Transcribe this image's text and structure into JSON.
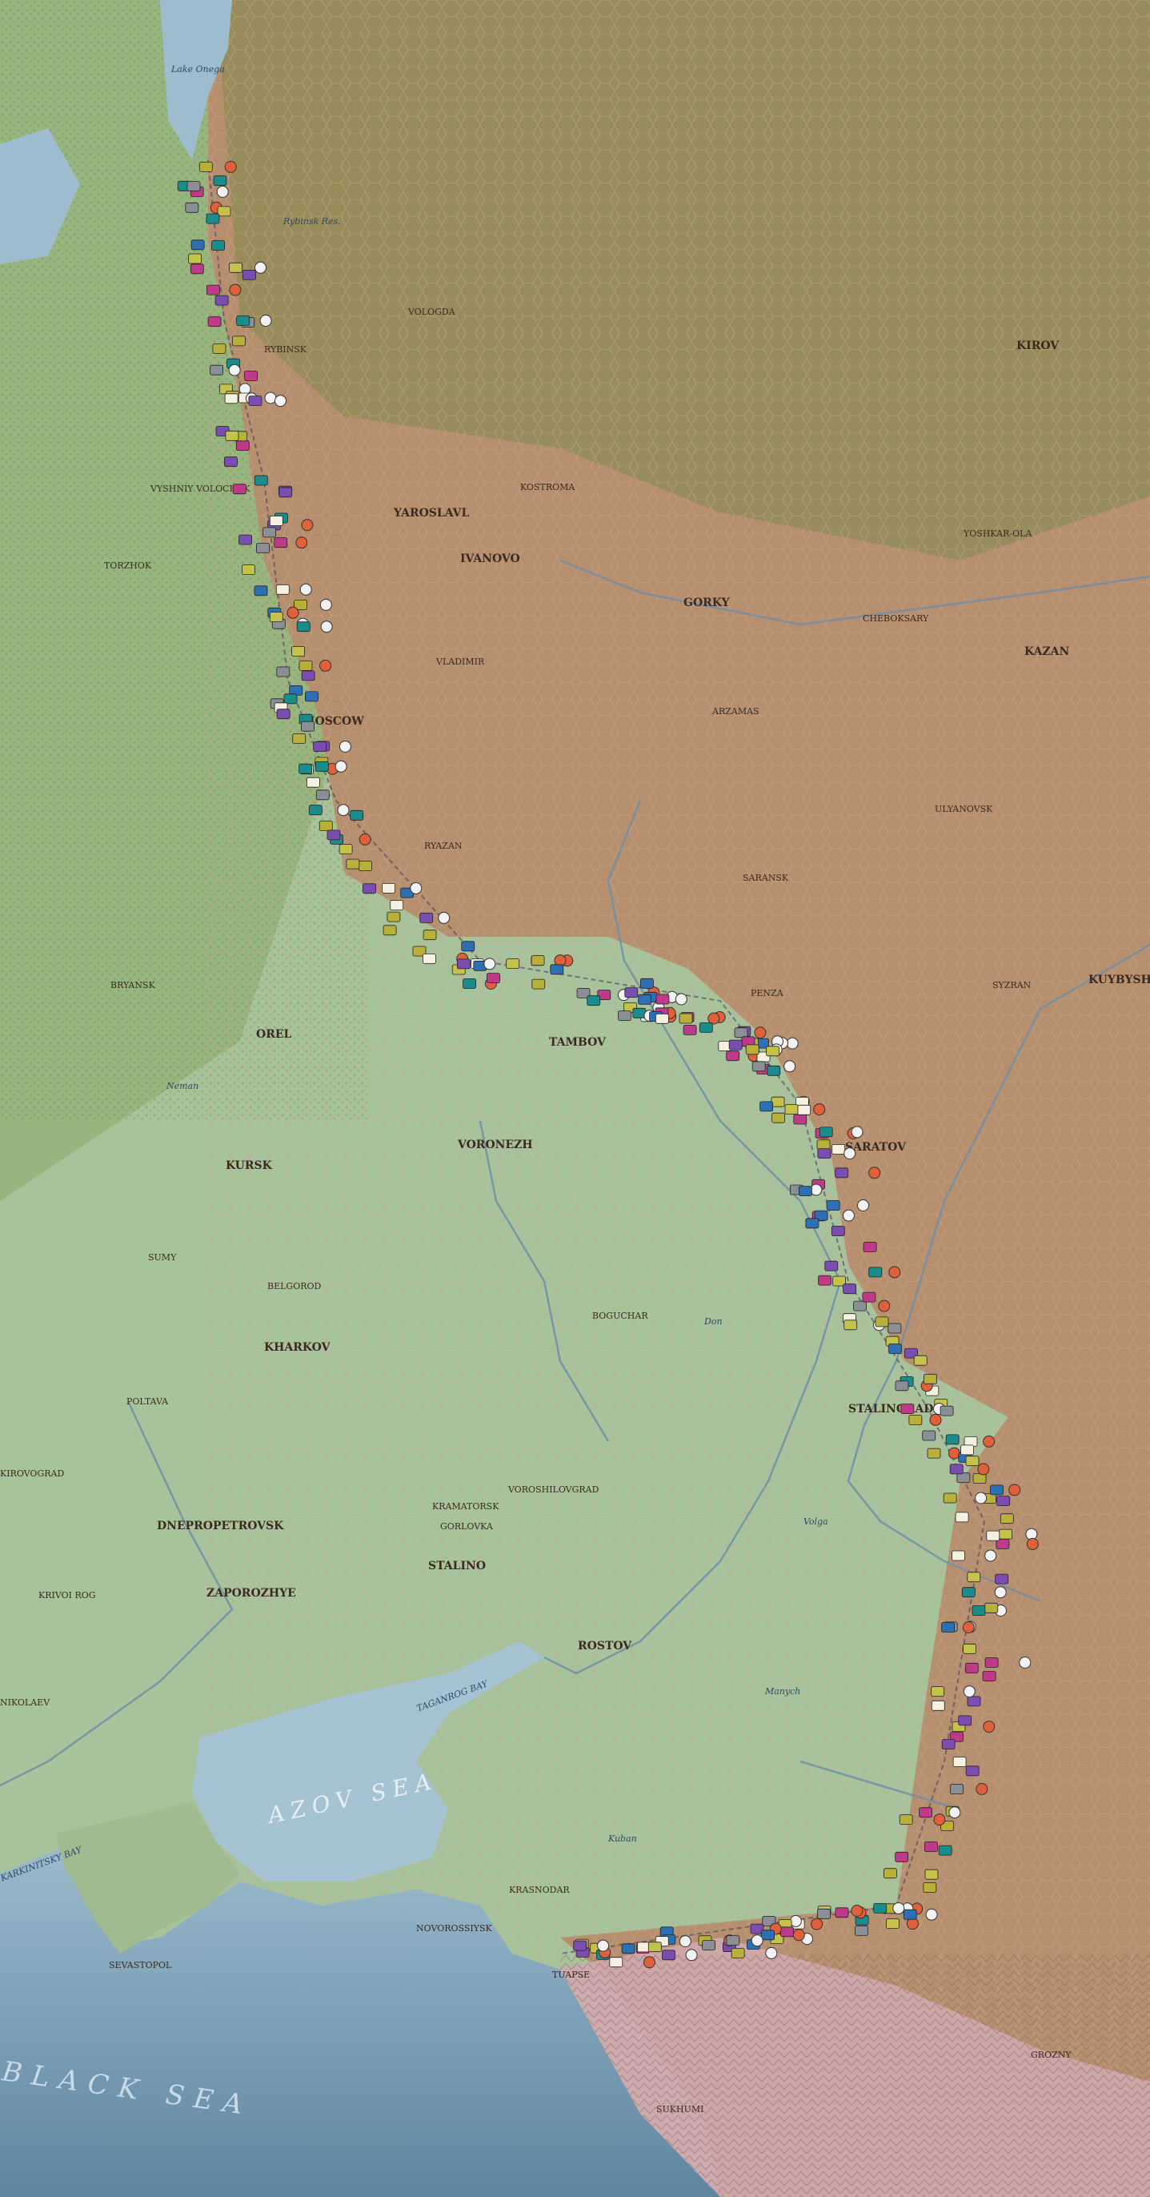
{
  "map": {
    "title": "",
    "colors": {
      "sea": "#8fb2c6",
      "deep_sea": "#6f93ab",
      "steppe": "#a9c49b",
      "forest": "#7f9e59",
      "occupied": "#b98a6a",
      "mountain": "#c9a6a6",
      "river": "#6f8ea8",
      "hexline": "#c9a48a",
      "axis_unit": "#b8b03a",
      "soviet_unit": "#f0f0e8"
    }
  },
  "labels": {
    "cities": [
      {
        "name": "KIROV",
        "cls": "big"
      },
      {
        "name": "KAZAN",
        "cls": "big"
      },
      {
        "name": "KUYBYSHEV",
        "cls": "big"
      },
      {
        "name": "YAROSLAVL",
        "cls": "big"
      },
      {
        "name": "IVANOVO",
        "cls": "big"
      },
      {
        "name": "GORKY",
        "cls": "big"
      },
      {
        "name": "MOSCOW",
        "cls": "big"
      },
      {
        "name": "OREL",
        "cls": "big"
      },
      {
        "name": "KURSK",
        "cls": "big"
      },
      {
        "name": "VORONEZH",
        "cls": "big"
      },
      {
        "name": "TAMBOV",
        "cls": "big"
      },
      {
        "name": "SARATOV",
        "cls": "big"
      },
      {
        "name": "KHARKOV",
        "cls": "big"
      },
      {
        "name": "DNEPROPETROVSK",
        "cls": "big"
      },
      {
        "name": "ZAPOROZHYE",
        "cls": "big"
      },
      {
        "name": "STALINO",
        "cls": "big"
      },
      {
        "name": "ROSTOV",
        "cls": "big"
      },
      {
        "name": "STALINGRAD",
        "cls": "big"
      },
      {
        "name": "VOLOGDA",
        "cls": ""
      },
      {
        "name": "RYBINSK",
        "cls": ""
      },
      {
        "name": "VLADIMIR",
        "cls": ""
      },
      {
        "name": "RYAZAN",
        "cls": ""
      },
      {
        "name": "PENZA",
        "cls": ""
      },
      {
        "name": "SARANSK",
        "cls": ""
      },
      {
        "name": "BRYANSK",
        "cls": ""
      },
      {
        "name": "BELGOROD",
        "cls": ""
      },
      {
        "name": "SUMY",
        "cls": ""
      },
      {
        "name": "POLTAVA",
        "cls": ""
      },
      {
        "name": "BOGUCHAR",
        "cls": ""
      },
      {
        "name": "VOROSHILOVGRAD",
        "cls": ""
      },
      {
        "name": "KRAMATORSK",
        "cls": ""
      },
      {
        "name": "GORLOVKA",
        "cls": ""
      },
      {
        "name": "KRIVOI ROG",
        "cls": ""
      },
      {
        "name": "NIKOLAEV",
        "cls": ""
      },
      {
        "name": "TORZHOK",
        "cls": ""
      },
      {
        "name": "VYSHNIY VOLOCHEK",
        "cls": ""
      },
      {
        "name": "KRASNODAR",
        "cls": ""
      },
      {
        "name": "NOVOROSSIYSK",
        "cls": ""
      },
      {
        "name": "SEVASTOPOL",
        "cls": ""
      },
      {
        "name": "TUAPSE",
        "cls": ""
      },
      {
        "name": "SUKHUMI",
        "cls": ""
      },
      {
        "name": "GROZNY",
        "cls": ""
      },
      {
        "name": "KOSTROMA",
        "cls": ""
      },
      {
        "name": "CHEBOKSARY",
        "cls": ""
      },
      {
        "name": "ULYANOVSK",
        "cls": ""
      },
      {
        "name": "ARZAMAS",
        "cls": ""
      },
      {
        "name": "YOSHKAR-OLA",
        "cls": ""
      },
      {
        "name": "SYZRAN",
        "cls": ""
      },
      {
        "name": "KIROVOGRAD",
        "cls": ""
      }
    ],
    "features": [
      {
        "name": "Don",
        "cls": "nat"
      },
      {
        "name": "Volga",
        "cls": "nat"
      },
      {
        "name": "Manych",
        "cls": "nat"
      },
      {
        "name": "Kuban",
        "cls": "nat"
      },
      {
        "name": "Neman",
        "cls": "nat"
      },
      {
        "name": "Lake Onega",
        "cls": "nat"
      },
      {
        "name": "Rybinsk Res.",
        "cls": "nat"
      }
    ],
    "seas": [
      {
        "name": "BLACK SEA",
        "cls": "sea"
      },
      {
        "name": "AZOV SEA",
        "cls": "azov"
      },
      {
        "name": "TAGANROG BAY",
        "cls": "nat"
      },
      {
        "name": "KARKINITSKY BAY",
        "cls": "nat"
      }
    ]
  }
}
